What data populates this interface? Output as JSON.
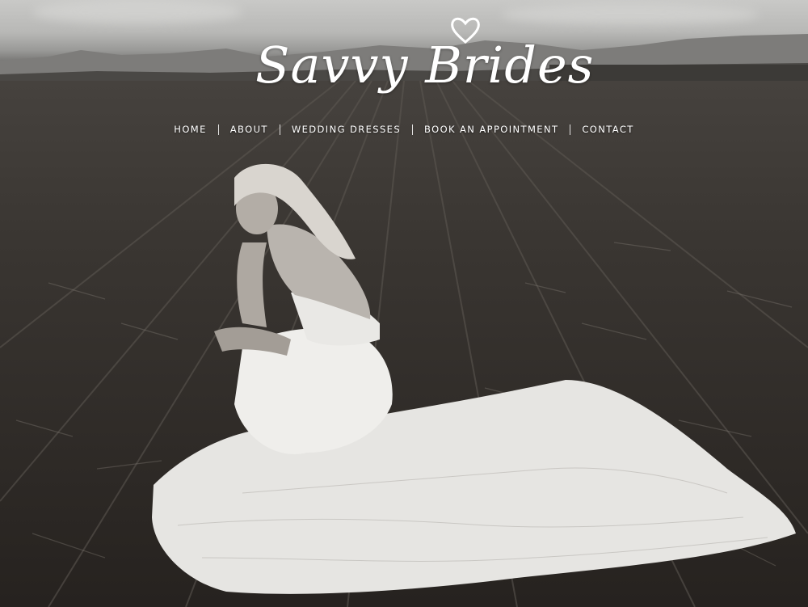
{
  "site": {
    "logo_text": "Savvy Brides",
    "logo_icon": "heart-icon"
  },
  "nav": {
    "items": [
      {
        "label": "HOME"
      },
      {
        "label": "ABOUT"
      },
      {
        "label": "WEDDING DRESSES"
      },
      {
        "label": "BOOK AN APPOINTMENT"
      },
      {
        "label": "CONTACT"
      }
    ]
  },
  "hero": {
    "image_icon": "bride-photo"
  },
  "colors": {
    "text": "#ffffff",
    "field_dark": "#262320",
    "sky": "#c9c9c7",
    "dress": "#f2f2f0"
  }
}
